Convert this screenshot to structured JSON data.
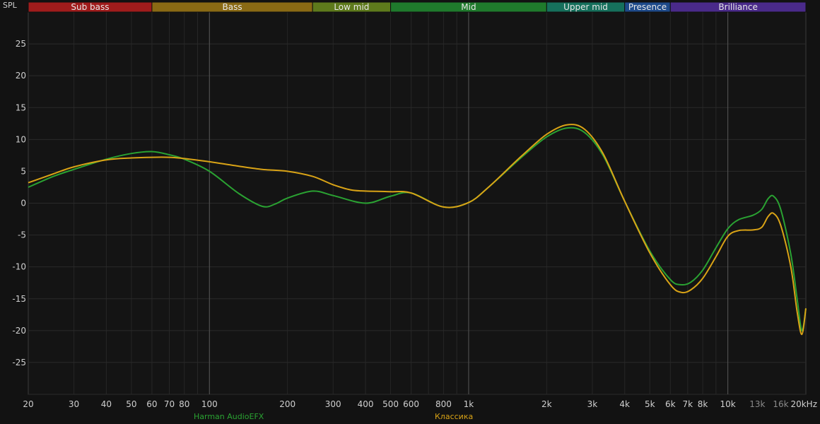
{
  "chart_data": {
    "type": "line",
    "y_axis_label": "SPL",
    "x_scale": "log",
    "xlim": [
      20,
      20000
    ],
    "ylim": [
      -30,
      30
    ],
    "y_ticks": [
      25,
      20,
      15,
      10,
      5,
      0,
      -5,
      -10,
      -15,
      -20,
      -25
    ],
    "x_ticks": [
      {
        "value": 20,
        "label": "20"
      },
      {
        "value": 30,
        "label": "30"
      },
      {
        "value": 40,
        "label": "40"
      },
      {
        "value": 50,
        "label": "50"
      },
      {
        "value": 60,
        "label": "60"
      },
      {
        "value": 70,
        "label": "70"
      },
      {
        "value": 80,
        "label": "80"
      },
      {
        "value": 100,
        "label": "100"
      },
      {
        "value": 200,
        "label": "200"
      },
      {
        "value": 300,
        "label": "300"
      },
      {
        "value": 400,
        "label": "400"
      },
      {
        "value": 500,
        "label": "500"
      },
      {
        "value": 600,
        "label": "600"
      },
      {
        "value": 800,
        "label": "800"
      },
      {
        "value": 1000,
        "label": "1k"
      },
      {
        "value": 2000,
        "label": "2k"
      },
      {
        "value": 3000,
        "label": "3k"
      },
      {
        "value": 4000,
        "label": "4k"
      },
      {
        "value": 5000,
        "label": "5k"
      },
      {
        "value": 6000,
        "label": "6k"
      },
      {
        "value": 7000,
        "label": "7k"
      },
      {
        "value": 8000,
        "label": "8k"
      },
      {
        "value": 10000,
        "label": "10k"
      },
      {
        "value": 13000,
        "label": "13k",
        "dim": true
      },
      {
        "value": 16000,
        "label": "16k",
        "dim": true
      },
      {
        "value": 20000,
        "label": "20kHz"
      }
    ],
    "grid": true,
    "major_vlines": [
      100,
      1000,
      10000
    ],
    "bands": [
      {
        "name": "Sub bass",
        "from": 20,
        "to": 60,
        "color": "#a01c1c"
      },
      {
        "name": "Bass",
        "from": 60,
        "to": 250,
        "color": "#8a6a14"
      },
      {
        "name": "Low mid",
        "from": 250,
        "to": 500,
        "color": "#5e7a1c"
      },
      {
        "name": "Mid",
        "from": 500,
        "to": 2000,
        "color": "#1f7a2c"
      },
      {
        "name": "Upper mid",
        "from": 2000,
        "to": 4000,
        "color": "#16705c"
      },
      {
        "name": "Presence",
        "from": 4000,
        "to": 6000,
        "color": "#1e4a8a"
      },
      {
        "name": "Brilliance",
        "from": 6000,
        "to": 20000,
        "color": "#4a2a8a"
      }
    ],
    "series": [
      {
        "name": "Harman AudioEFX",
        "color": "#2aa232",
        "x": [
          20,
          25,
          30,
          40,
          50,
          60,
          70,
          80,
          100,
          130,
          160,
          180,
          200,
          250,
          300,
          400,
          500,
          600,
          800,
          1000,
          1200,
          1600,
          2000,
          2400,
          2800,
          3300,
          4000,
          5000,
          6000,
          6600,
          7200,
          8000,
          9000,
          10000,
          11000,
          12500,
          13500,
          14300,
          15000,
          16000,
          17500,
          18500,
          19300,
          20000
        ],
        "y": [
          2.5,
          4.2,
          5.3,
          6.9,
          7.8,
          8.1,
          7.6,
          6.9,
          5.0,
          1.5,
          -0.5,
          -0.1,
          0.8,
          1.9,
          1.2,
          0.0,
          1.1,
          1.6,
          -0.6,
          0.1,
          2.6,
          7.2,
          10.4,
          11.8,
          11.1,
          7.5,
          0.3,
          -7.5,
          -12.0,
          -12.8,
          -12.4,
          -10.5,
          -7.0,
          -4.0,
          -2.6,
          -1.9,
          -1.0,
          0.7,
          1.1,
          -1.0,
          -8.0,
          -15.0,
          -20.0,
          -16.5
        ]
      },
      {
        "name": "Классика",
        "color": "#d9a316",
        "x": [
          20,
          25,
          30,
          40,
          50,
          60,
          70,
          80,
          100,
          130,
          160,
          200,
          250,
          300,
          350,
          400,
          500,
          600,
          800,
          1000,
          1200,
          1600,
          2000,
          2400,
          2800,
          3300,
          4000,
          5000,
          6000,
          6600,
          7200,
          8000,
          9000,
          10000,
          11000,
          12500,
          13500,
          14300,
          15000,
          16000,
          17500,
          18500,
          19300,
          20000
        ],
        "y": [
          3.2,
          4.6,
          5.7,
          6.8,
          7.1,
          7.2,
          7.2,
          7.0,
          6.5,
          5.8,
          5.3,
          5.0,
          4.2,
          2.9,
          2.1,
          1.9,
          1.8,
          1.6,
          -0.6,
          0.1,
          2.6,
          7.4,
          10.8,
          12.3,
          11.6,
          7.8,
          0.3,
          -7.8,
          -12.8,
          -14.0,
          -13.6,
          -11.8,
          -8.4,
          -5.2,
          -4.3,
          -4.2,
          -3.8,
          -2.1,
          -1.6,
          -3.5,
          -10.0,
          -17.0,
          -20.6,
          -16.5
        ]
      }
    ]
  }
}
